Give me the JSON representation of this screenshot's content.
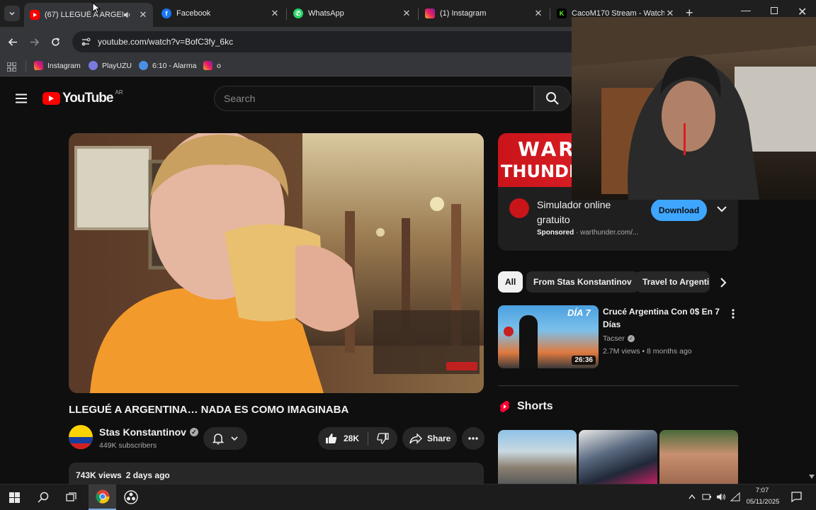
{
  "browser": {
    "tabs": [
      {
        "title": "(67) LLEGUÉ A ARGENTI",
        "icon": "youtube-icon",
        "active": true
      },
      {
        "title": "Facebook",
        "icon": "facebook-icon"
      },
      {
        "title": "WhatsApp",
        "icon": "whatsapp-icon"
      },
      {
        "title": "(1) Instagram",
        "icon": "instagram-icon"
      },
      {
        "title": "CacoM170 Stream - Watch",
        "icon": "kick-icon"
      }
    ],
    "url": "youtube.com/watch?v=BofC3fy_6kc",
    "bookmarks": [
      {
        "label": "Instagram",
        "icon": "instagram-icon"
      },
      {
        "label": "PlayUZU",
        "icon": "playuzu-icon"
      },
      {
        "label": "6:10 - Alarma",
        "icon": "alarm-icon"
      },
      {
        "label": "o",
        "icon": "instagram-icon"
      }
    ]
  },
  "youtube": {
    "logo_text": "YouTube",
    "region": "AR",
    "search_placeholder": "Search",
    "video": {
      "title": "LLEGUÉ A ARGENTINA… NADA ES COMO IMAGINABA",
      "channel": "Stas Konstantinov",
      "subscribers": "449K subscribers",
      "likes": "28K",
      "share_label": "Share",
      "views": "743K views",
      "age": "2 days ago"
    },
    "ad": {
      "banner_line1": "WAR",
      "banner_line2": "THUNDER",
      "title_line1": "Simulador online",
      "title_line2": "gratuito",
      "sponsored": "Sponsored",
      "domain": "warthunder.com/...",
      "cta": "Download"
    },
    "chips": [
      "All",
      "From Stas Konstantinov",
      "Travel to Argentin"
    ],
    "recommended": [
      {
        "title_line1": "Crucé Argentina Con 0$ En 7",
        "title_line2": "Días",
        "channel": "Tacser",
        "meta": "2.7M views • 8 months ago",
        "duration": "26:36",
        "thumb_text": "DÍA 7"
      }
    ],
    "shorts_label": "Shorts"
  },
  "taskbar": {
    "time": "7:07",
    "date": "05/11/2025"
  },
  "colors": {
    "accent_red": "#ff0000",
    "download_blue": "#3ea6ff",
    "youtube_bg": "#0f0f0f"
  }
}
